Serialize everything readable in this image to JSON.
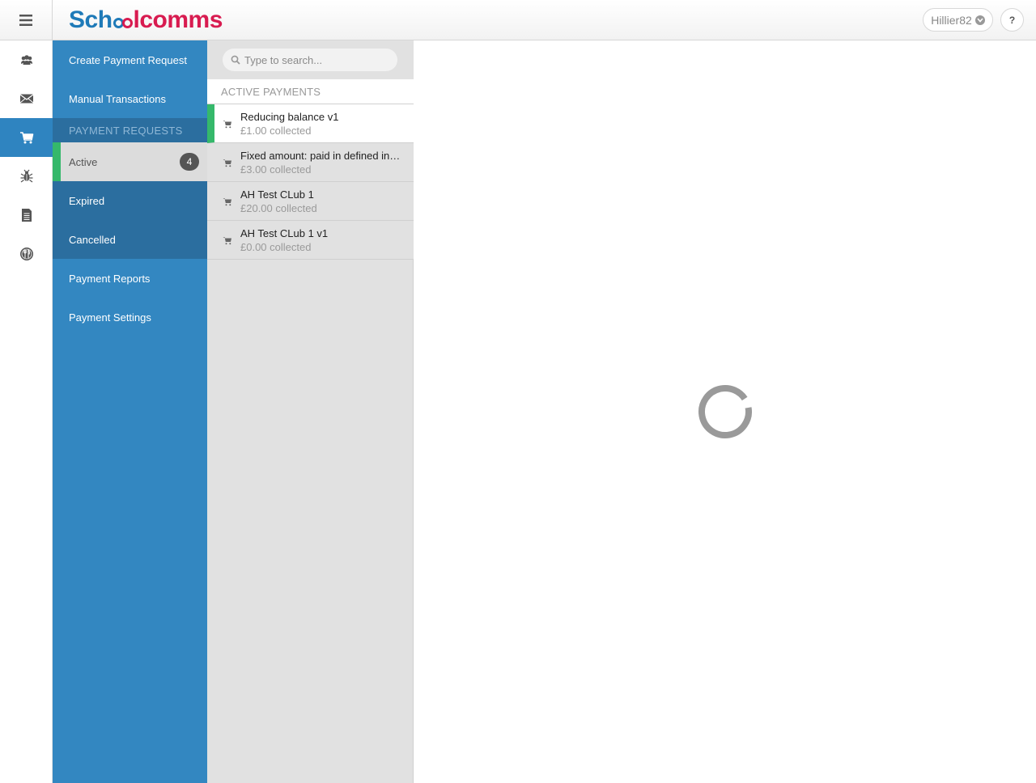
{
  "header": {
    "logo": {
      "part1": "Sch",
      "part2": "lcomms"
    },
    "user": "Hillier82",
    "help_label": "?"
  },
  "rail": {
    "items": [
      {
        "icon": "people-icon"
      },
      {
        "icon": "envelope-icon"
      },
      {
        "icon": "cart-icon",
        "active": true
      },
      {
        "icon": "bug-icon"
      },
      {
        "icon": "document-icon"
      },
      {
        "icon": "cutlery-icon"
      }
    ]
  },
  "nav": {
    "create": "Create Payment Request",
    "manual": "Manual Transactions",
    "section": "PAYMENT REQUESTS",
    "active": "Active",
    "active_count": "4",
    "expired": "Expired",
    "cancelled": "Cancelled",
    "reports": "Payment Reports",
    "settings": "Payment Settings"
  },
  "list": {
    "search_placeholder": "Type to search...",
    "header": "ACTIVE PAYMENTS",
    "items": [
      {
        "title": "Reducing balance v1",
        "sub": "£1.00 collected"
      },
      {
        "title": "Fixed amount: paid in defined instalments",
        "sub": "£3.00 collected"
      },
      {
        "title": "AH Test CLub 1",
        "sub": "£20.00 collected"
      },
      {
        "title": "AH Test CLub 1 v1",
        "sub": "£0.00 collected"
      }
    ]
  },
  "colors": {
    "nav_blue": "#3387c1",
    "nav_dark": "#2b6e9f",
    "accent_green": "#35b86b",
    "logo_blue": "#1e7ab8",
    "logo_red": "#d81b50"
  }
}
